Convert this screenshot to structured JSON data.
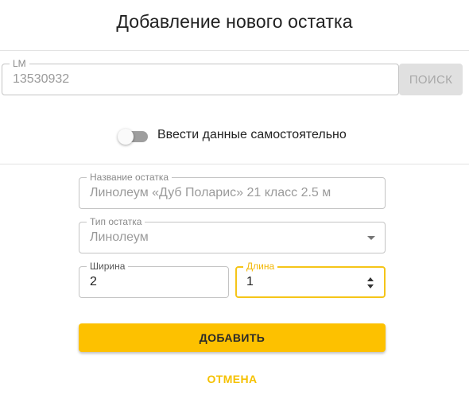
{
  "dialog": {
    "title": "Добавление нового остатка"
  },
  "lm_field": {
    "label": "LM",
    "value": "13530932"
  },
  "search_button": {
    "label": "ПОИСК"
  },
  "manual_toggle": {
    "label": "Ввести данные самостоятельно",
    "on": false
  },
  "name_field": {
    "label": "Название остатка",
    "value": "Линолеум «Дуб Поларис» 21 класс 2.5 м"
  },
  "type_field": {
    "label": "Тип остатка",
    "value": "Линолеум"
  },
  "width_field": {
    "label": "Ширина",
    "value": "2"
  },
  "length_field": {
    "label": "Длина",
    "value": "1"
  },
  "actions": {
    "add_label": "ДОБАВИТЬ",
    "cancel_label": "ОТМЕНА"
  },
  "colors": {
    "accent": "#fdc100",
    "focus_border": "#f5c518",
    "disabled_button": "#e0e0e0",
    "toggle_track": "#9e9e9e"
  },
  "icons": {
    "select": "chevron-down-icon",
    "spinner": "number-spinner-icon"
  }
}
